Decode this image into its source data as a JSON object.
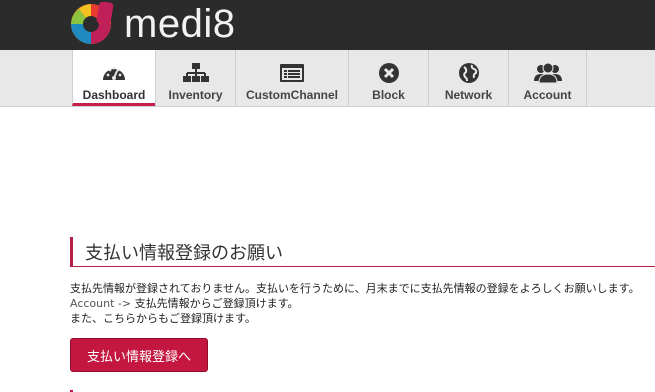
{
  "brand": {
    "name": "medi",
    "suffix": "8"
  },
  "nav": {
    "tabs": [
      {
        "label": "Dashboard",
        "icon": "dashboard-icon",
        "active": true
      },
      {
        "label": "Inventory",
        "icon": "sitemap-icon",
        "active": false
      },
      {
        "label": "CustomChannel",
        "icon": "list-window-icon",
        "active": false
      },
      {
        "label": "Block",
        "icon": "block-x-icon",
        "active": false
      },
      {
        "label": "Network",
        "icon": "globe-icon",
        "active": false
      },
      {
        "label": "Account",
        "icon": "users-icon",
        "active": false
      }
    ]
  },
  "page": {
    "title": "支払い情報登録のお願い",
    "line1": "支払先情報が登録されておりません。支払いを行うために、月末までに支払先情報の登録をよろしくお願いします。",
    "line2_accent": "Account ->",
    "line2_rest": " 支払先情報からご登録頂けます。",
    "line3": "また、こちらからもご登録頂けます。",
    "button": "支払い情報登録へ"
  },
  "colors": {
    "accent": "#c4173f",
    "topbar": "#2b2b2b",
    "navbar": "#e8e8e8"
  }
}
